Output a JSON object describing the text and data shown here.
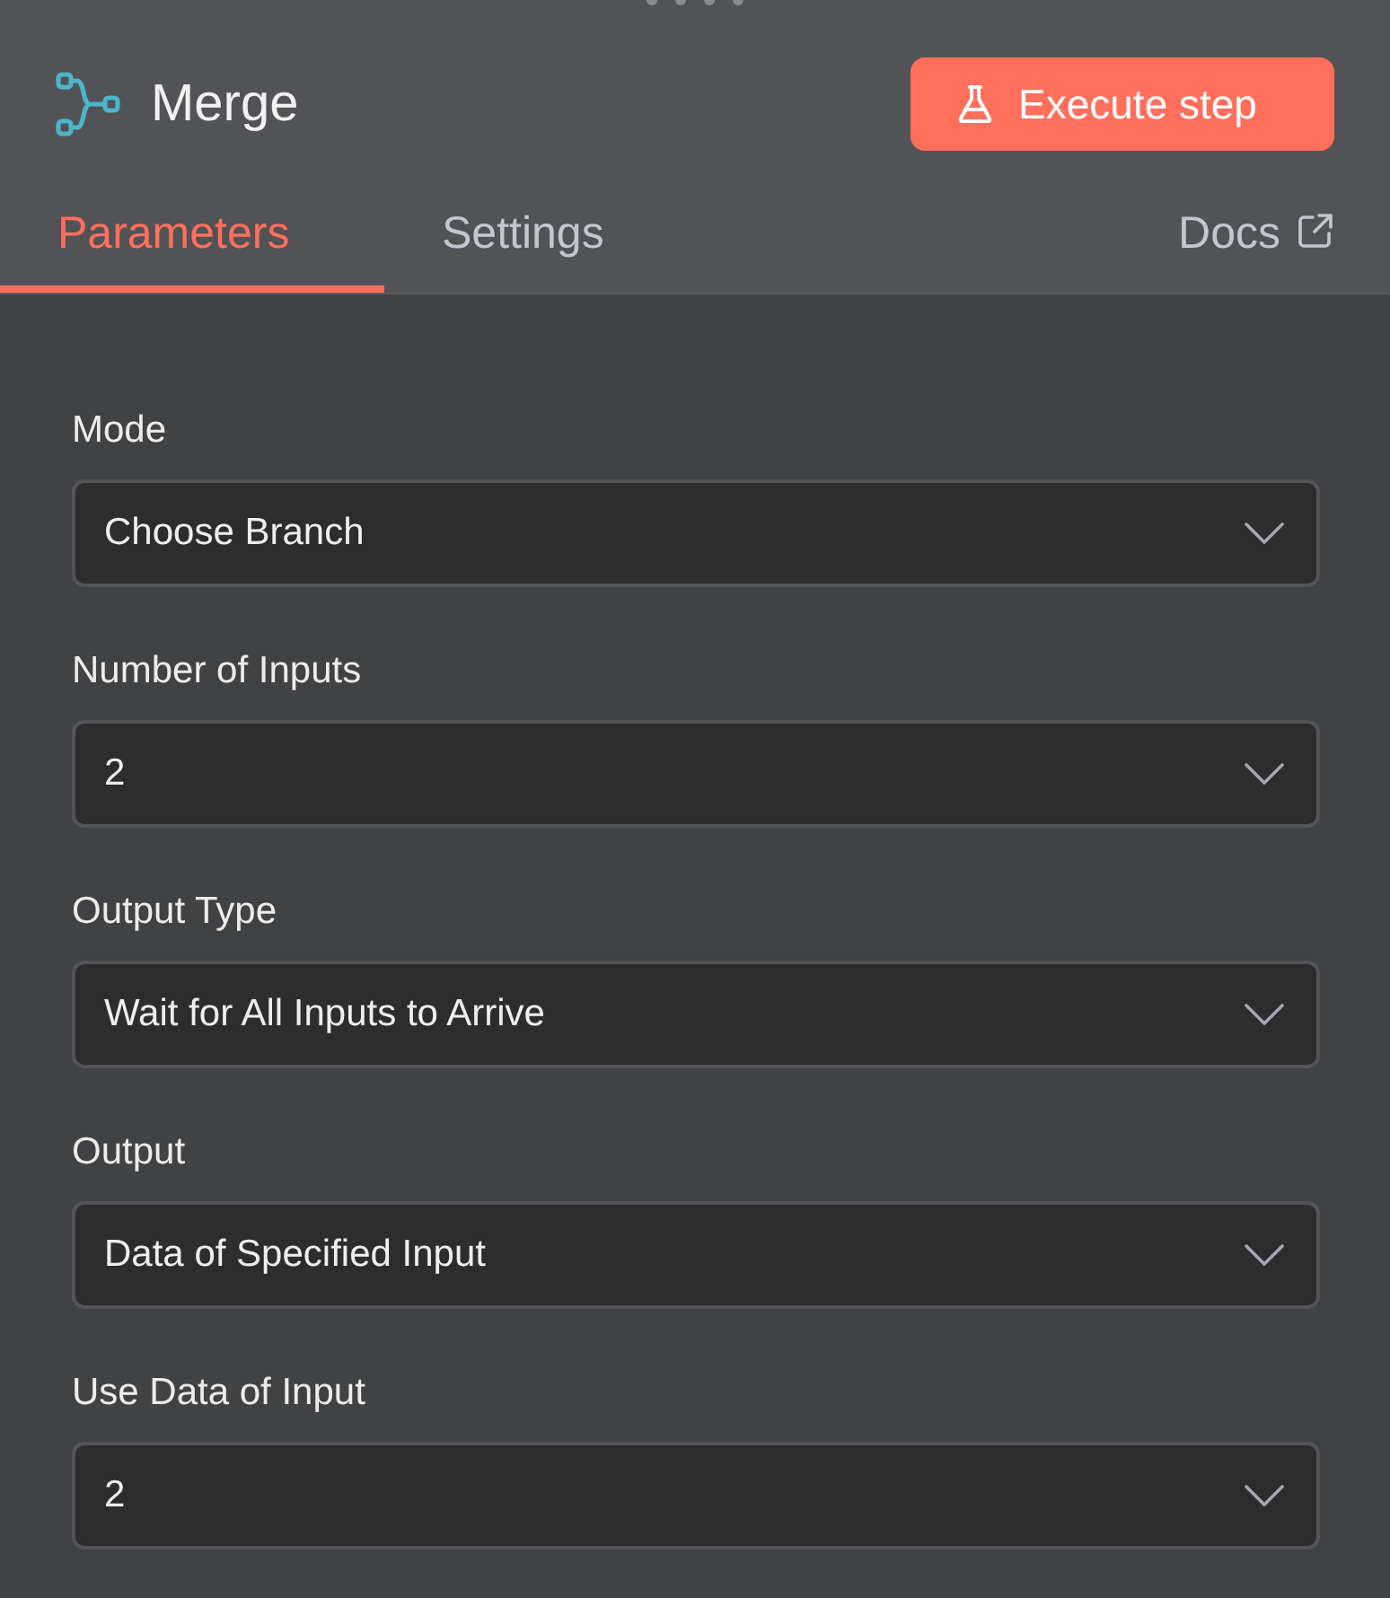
{
  "node": {
    "title": "Merge"
  },
  "execute_button": {
    "label": "Execute step"
  },
  "tabs": [
    {
      "label": "Parameters",
      "selected": true
    },
    {
      "label": "Settings",
      "selected": false
    }
  ],
  "docs_link": {
    "label": "Docs"
  },
  "parameters": [
    {
      "label": "Mode",
      "value": "Choose Branch"
    },
    {
      "label": "Number of Inputs",
      "value": "2"
    },
    {
      "label": "Output Type",
      "value": "Wait for All Inputs to Arrive"
    },
    {
      "label": "Output",
      "value": "Data of Specified Input"
    },
    {
      "label": "Use Data of Input",
      "value": "2"
    }
  ]
}
